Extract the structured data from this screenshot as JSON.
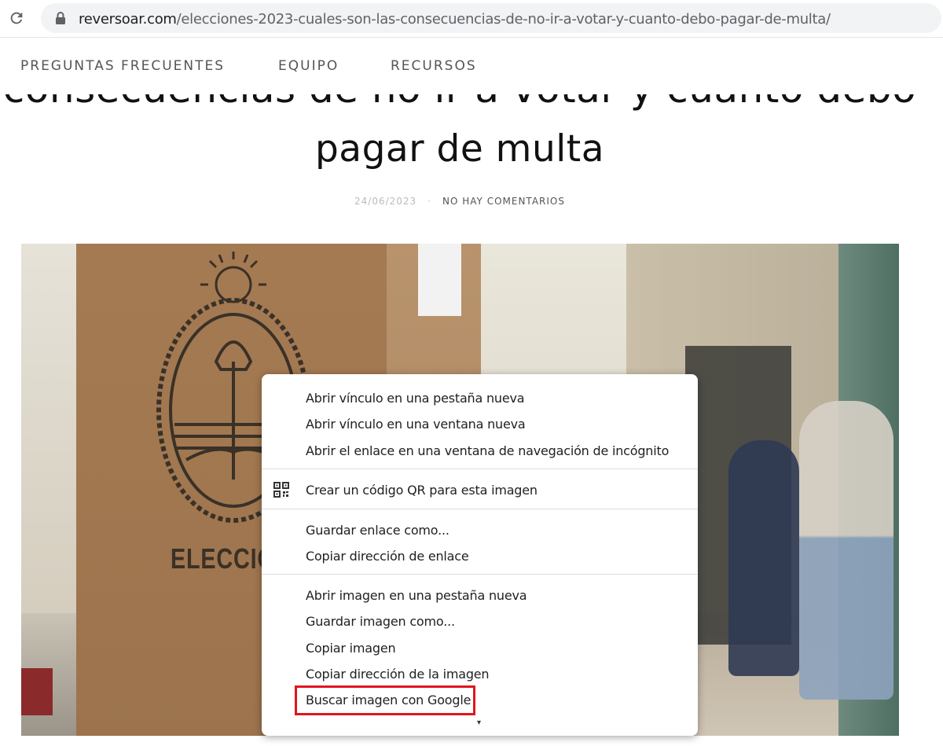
{
  "browser": {
    "url_host": "reversoar.com",
    "url_path": "/elecciones-2023-cuales-son-las-consecuencias-de-no-ir-a-votar-y-cuanto-debo-pagar-de-multa/"
  },
  "nav": {
    "items": [
      "PREGUNTAS FRECUENTES",
      "EQUIPO",
      "RECURSOS"
    ]
  },
  "article": {
    "title_line1": "consecuencias de no ir a votar y cuanto debo",
    "title_line2": "pagar de multa",
    "date": "24/06/2023",
    "separator": "·",
    "comments": "NO HAY COMENTARIOS",
    "image_text": "ELECCIONES N"
  },
  "context_menu": {
    "items": [
      "Abrir vínculo en una pestaña nueva",
      "Abrir vínculo en una ventana nueva",
      "Abrir el enlace en una ventana de navegación de incógnito",
      "Crear un código QR para esta imagen",
      "Guardar enlace como...",
      "Copiar dirección de enlace",
      "Abrir imagen en una pestaña nueva",
      "Guardar imagen como...",
      "Copiar imagen",
      "Copiar dirección de la imagen",
      "Buscar imagen con Google"
    ],
    "highlighted_item": "Buscar imagen con Google",
    "highlight_color": "#e0161f"
  },
  "icons": [
    "reload-icon",
    "lock-icon",
    "qr-code-icon"
  ]
}
